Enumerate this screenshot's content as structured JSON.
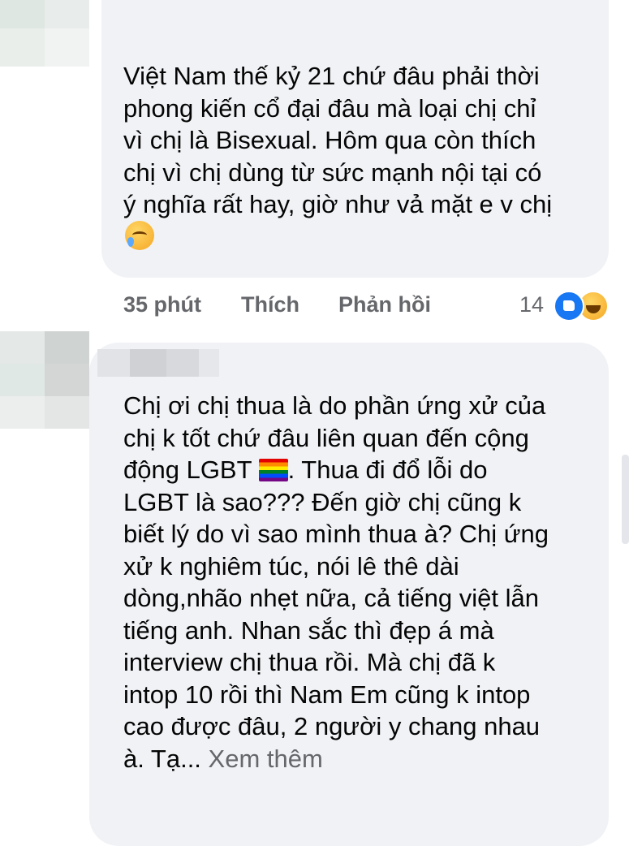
{
  "comments": [
    {
      "text": "Việt Nam thế kỷ 21 chứ đâu phải thời\nphong kiến cổ đại đâu mà loại chị chỉ\nvì chị là Bisexual. Hôm qua còn thích\nchị vì chị dùng từ sức mạnh nội tại có\ný nghĩa rất hay, giờ như vả mặt e v chị",
      "emoji": "crying-face-emoji",
      "time": "35 phút",
      "like_label": "Thích",
      "reply_label": "Phản hồi",
      "reaction_count": "14",
      "reactions": [
        "like-icon",
        "haha-icon"
      ]
    },
    {
      "text_part1": "Chị ơi chị thua là do phần ứng xử của\nchị k tốt chứ đâu liên quan đến cộng\nđộng LGBT ",
      "flag_emoji": "rainbow-flag-emoji",
      "text_part2": ". Thua đi đổ lỗi do\nLGBT là sao??? Đến giờ chị cũng k\nbiết lý do vì sao mình thua à? Chị ứng\nxử k nghiêm túc, nói lê thê dài\ndòng,nhão nhẹt nữa, cả tiếng việt lẫn\ntiếng anh. Nhan sắc thì đẹp á mà\ninterview chị thua rồi. Mà chị đã k\nintop 10 rồi thì Nam Em cũng k intop\ncao được đâu, 2 người y chang nhau\nà. Tạ...",
      "see_more": " Xem thêm"
    }
  ],
  "colors": {
    "bubble_bg": "#f0f2f5",
    "meta_text": "#65676b",
    "like_blue": "#1877f2"
  }
}
